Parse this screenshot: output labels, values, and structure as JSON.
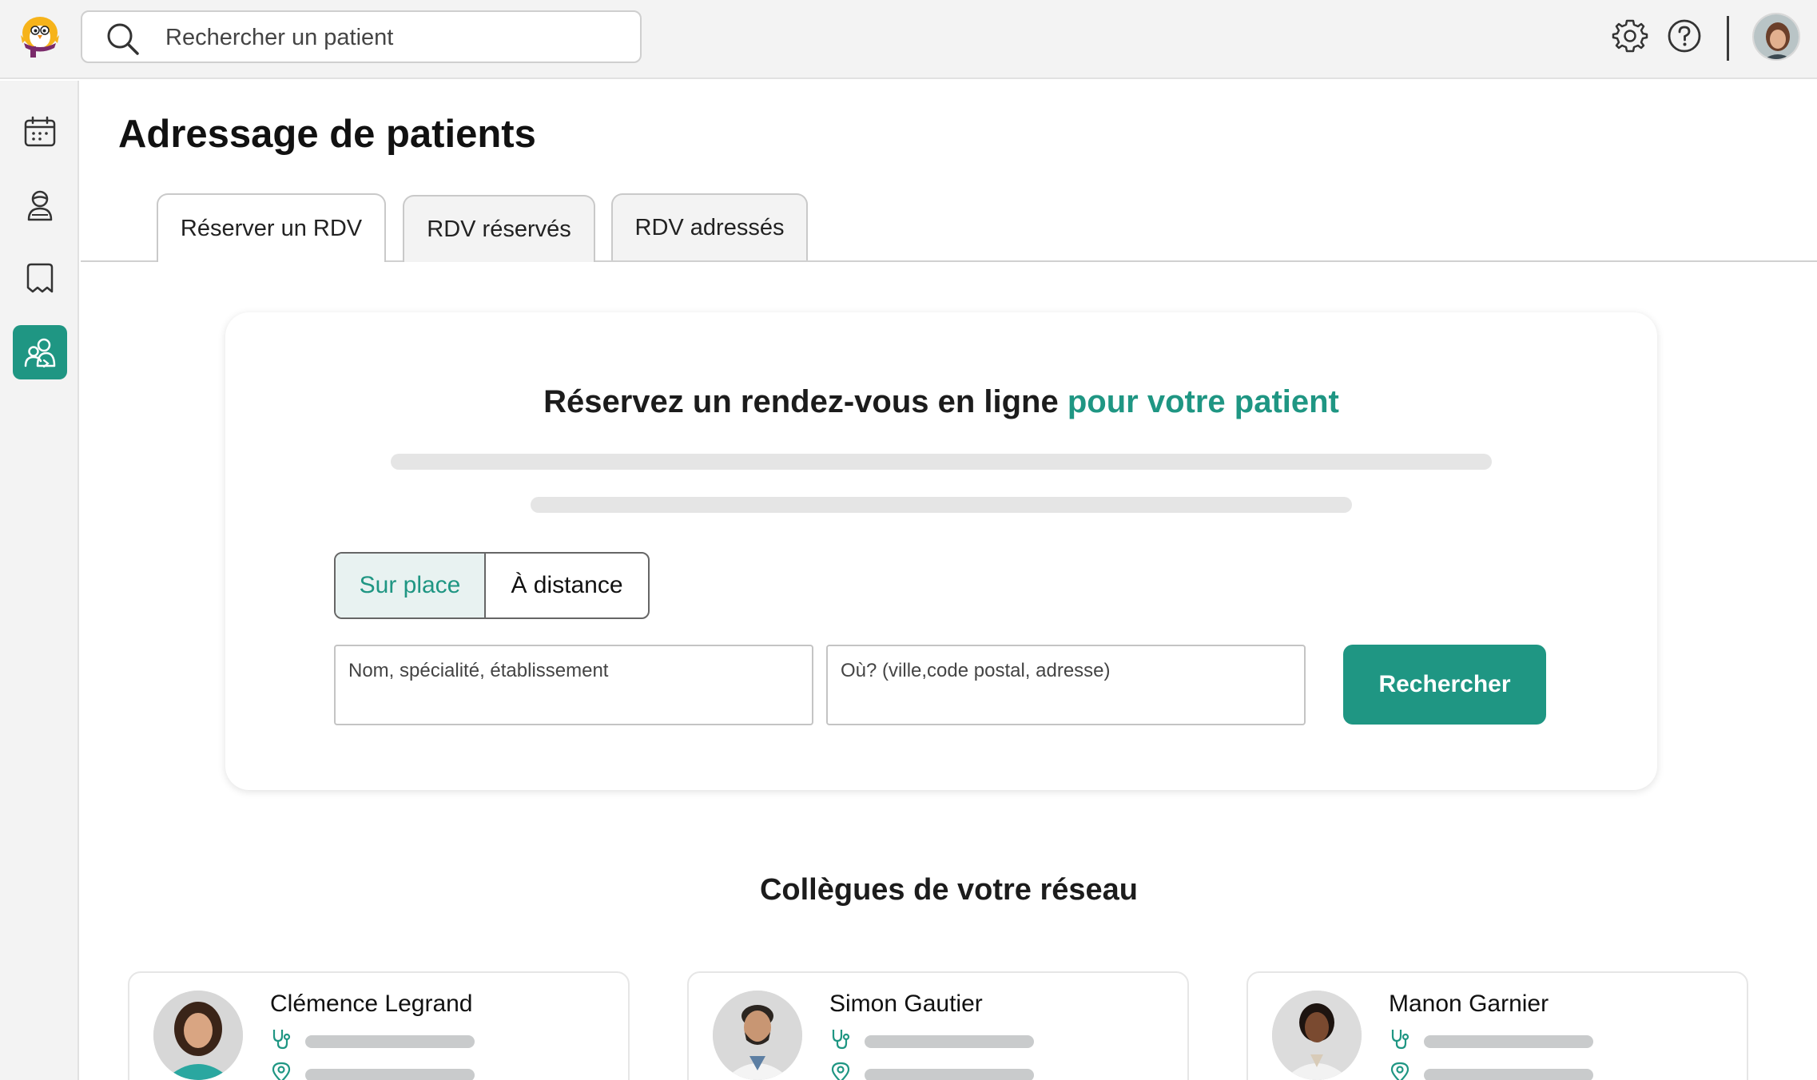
{
  "search": {
    "placeholder": "Rechercher un patient"
  },
  "page": {
    "title": "Adressage de patients"
  },
  "tabs": [
    {
      "label": "Réserver un RDV",
      "active": true
    },
    {
      "label": "RDV réservés",
      "active": false
    },
    {
      "label": "RDV adressés",
      "active": false
    }
  ],
  "booking": {
    "heading": "Réservez un rendez-vous en ligne ",
    "heading_accent": "pour votre patient",
    "mode_options": [
      "Sur place",
      "À distance"
    ],
    "selected_mode": "Sur place",
    "name_placeholder": "Nom, spécialité, établissement",
    "location_placeholder": "Où? (ville,code postal, adresse)",
    "search_button": "Rechercher"
  },
  "network": {
    "title": "Collègues de votre réseau",
    "colleagues": [
      {
        "name": "Clémence Legrand"
      },
      {
        "name": "Simon Gautier"
      },
      {
        "name": "Manon Garnier"
      }
    ]
  },
  "colors": {
    "accent": "#1f9683",
    "accent_light": "#e8f2f1",
    "skeleton": "#e5e5e5"
  },
  "icons": {
    "top": [
      "settings-icon",
      "help-icon"
    ],
    "sidebar": [
      "calendar-icon",
      "patient-icon",
      "messages-icon",
      "referral-icon"
    ]
  }
}
